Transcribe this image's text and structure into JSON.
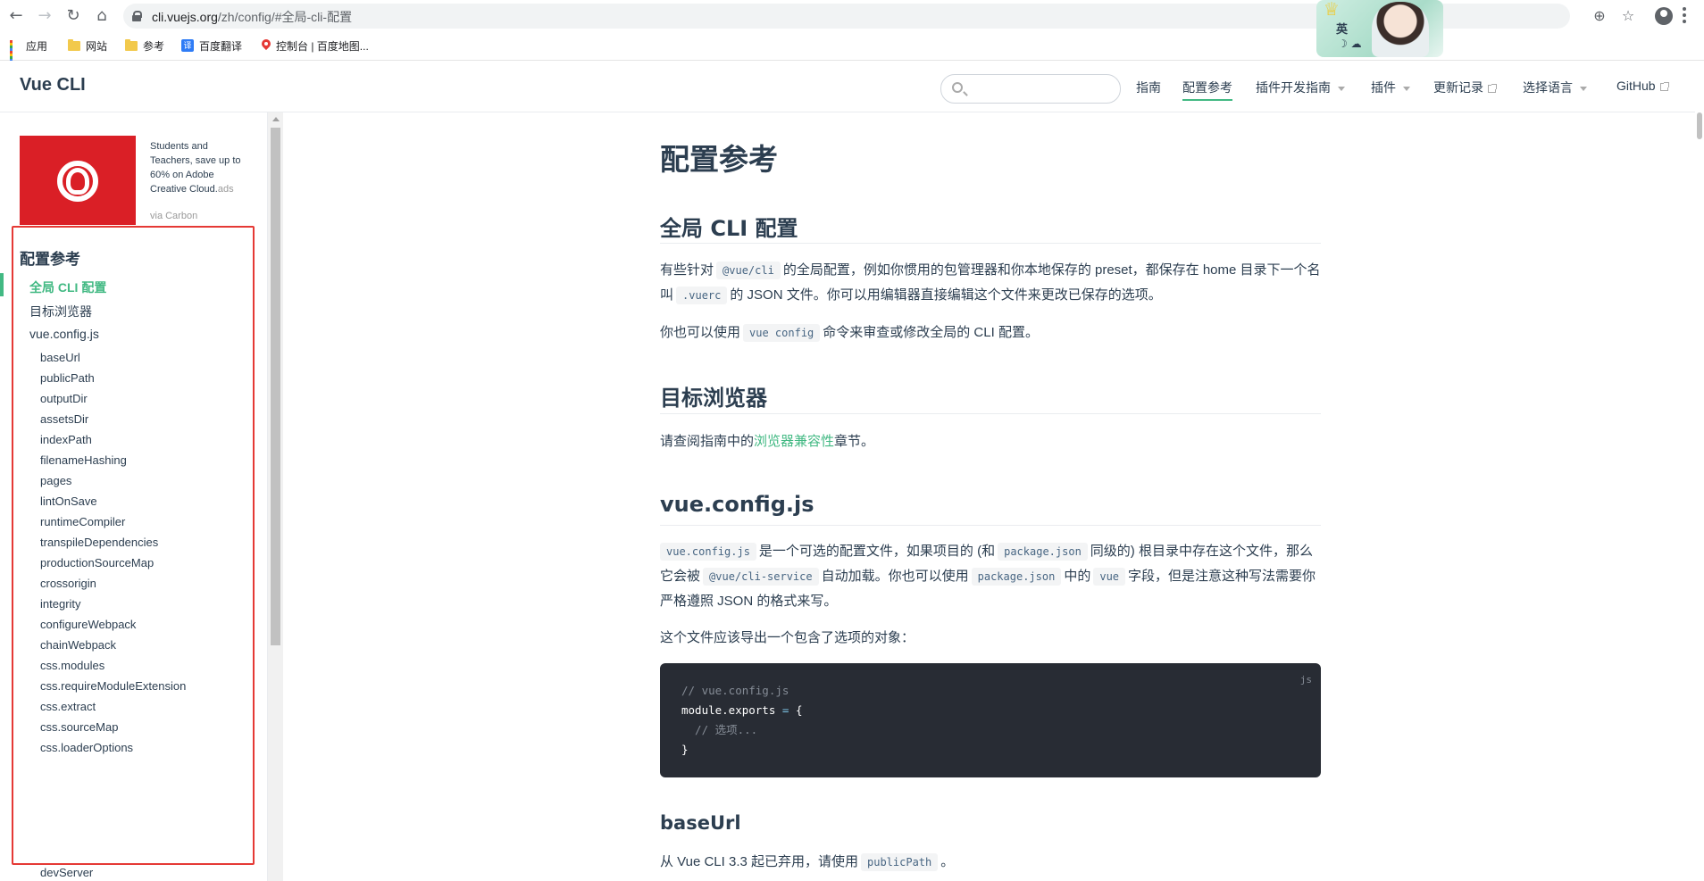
{
  "browser": {
    "url_host": "cli.vuejs.org",
    "url_path": "/zh/config/#全局-cli-配置",
    "bookmarks": [
      "应用",
      "网站",
      "参考",
      "百度翻译",
      "控制台 | 百度地图..."
    ],
    "sticker_text": "英",
    "sticker_sub": "☽ ☁"
  },
  "header": {
    "title": "Vue CLI",
    "search_placeholder": "",
    "nav": [
      "指南",
      "配置参考",
      "插件开发指南",
      "插件",
      "更新记录",
      "选择语言",
      "GitHub"
    ]
  },
  "sidebar": {
    "ad_text": "Students and Teachers, save up to 60% on Adobe Creative Cloud.",
    "ad_suffix": "ads",
    "ad_via": "via Carbon",
    "heading": "配置参考",
    "items": [
      "全局 CLI 配置",
      "目标浏览器",
      "vue.config.js"
    ],
    "subitems": [
      "baseUrl",
      "publicPath",
      "outputDir",
      "assetsDir",
      "indexPath",
      "filenameHashing",
      "pages",
      "lintOnSave",
      "runtimeCompiler",
      "transpileDependencies",
      "productionSourceMap",
      "crossorigin",
      "integrity",
      "configureWebpack",
      "chainWebpack",
      "css.modules",
      "css.requireModuleExtension",
      "css.extract",
      "css.sourceMap",
      "css.loaderOptions",
      "devServer"
    ]
  },
  "content": {
    "title": "配置参考",
    "s1": {
      "heading": "全局 CLI 配置",
      "p1a": "有些针对",
      "p1code1": "@vue/cli",
      "p1b": "的全局配置，例如你惯用的包管理器和你本地保存的 preset，都保存在 home 目录下一个名叫",
      "p1code2": ".vuerc",
      "p1c": "的 JSON 文件。你可以用编辑器直接编辑这个文件来更改已保存的选项。",
      "p2a": "你也可以使用",
      "p2code": "vue config",
      "p2b": "命令来审查或修改全局的 CLI 配置。"
    },
    "s2": {
      "heading": "目标浏览器",
      "pa": "请查阅指南中的",
      "plink": "浏览器兼容性",
      "pb": "章节。"
    },
    "s3": {
      "heading": "vue.config.js",
      "c1": "vue.config.js",
      "t1": "是一个可选的配置文件，如果项目的 (和",
      "c2": "package.json",
      "t2": "同级的) 根目录中存在这个文件，那么它会被",
      "c3": "@vue/cli-service",
      "t3": "自动加载。你也可以使用",
      "c4": "package.json",
      "t4": "中的",
      "c5": "vue",
      "t5": "字段，但是注意这种写法需要你严格遵照 JSON 的格式来写。",
      "p2": "这个文件应该导出一个包含了选项的对象：",
      "code_lang": "js",
      "code_l1": "// vue.config.js",
      "code_l2a": "module.exports",
      "code_l2b": " = ",
      "code_l2c": "{",
      "code_l3": "  // 选项...",
      "code_l4": "}"
    },
    "s4": {
      "heading": "baseUrl",
      "pa": "从 Vue CLI 3.3 起已弃用，请使用",
      "pcode": "publicPath",
      "pb": "。"
    }
  },
  "colors": {
    "accent": "#42b983",
    "text": "#2c3e50",
    "highlight_box": "#e53935",
    "code_bg": "#282c34"
  }
}
